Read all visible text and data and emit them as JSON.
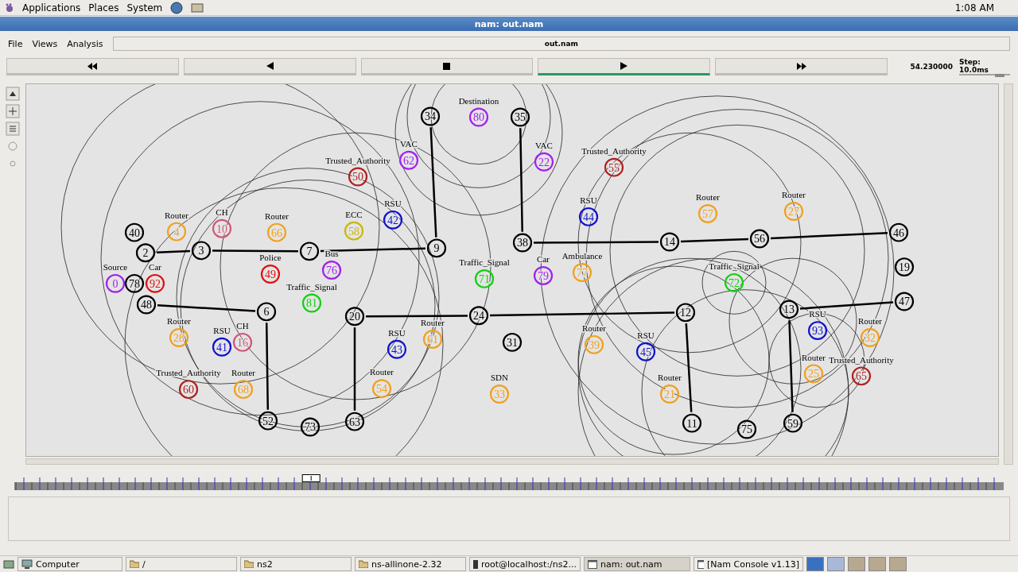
{
  "top_panel": {
    "menus": [
      "Applications",
      "Places",
      "System"
    ],
    "clock": "1:08 AM"
  },
  "window": {
    "title": "nam: out.nam"
  },
  "menubar": {
    "items": [
      "File",
      "Views",
      "Analysis"
    ],
    "file_name": "out.nam"
  },
  "transport": [
    {
      "kind": "rewind",
      "selected": false
    },
    {
      "kind": "back",
      "selected": false
    },
    {
      "kind": "stop",
      "selected": false
    },
    {
      "kind": "play",
      "selected": true
    },
    {
      "kind": "forward",
      "selected": false
    }
  ],
  "time": "54.230000",
  "step": {
    "label": "Step: 10.0ms",
    "level": 0.8
  },
  "nodes": [
    {
      "number": "40",
      "color": "#000000"
    },
    {
      "number": "2",
      "color": "#000000"
    },
    {
      "number": "3",
      "color": "#000000"
    },
    {
      "number": "7",
      "color": "#000000"
    },
    {
      "number": "48",
      "color": "#000000"
    },
    {
      "number": "6",
      "color": "#000000"
    },
    {
      "number": "52",
      "color": "#000000"
    },
    {
      "number": "73",
      "color": "#000000"
    },
    {
      "number": "20",
      "color": "#000000"
    },
    {
      "number": "63",
      "color": "#000000"
    },
    {
      "number": "9",
      "color": "#000000"
    },
    {
      "number": "34",
      "color": "#000000"
    },
    {
      "number": "35",
      "color": "#000000"
    },
    {
      "number": "38",
      "color": "#000000"
    },
    {
      "number": "24",
      "color": "#000000"
    },
    {
      "number": "31",
      "color": "#000000"
    },
    {
      "number": "14",
      "color": "#000000"
    },
    {
      "number": "56",
      "color": "#000000"
    },
    {
      "number": "46",
      "color": "#000000"
    },
    {
      "number": "19",
      "color": "#000000"
    },
    {
      "number": "47",
      "color": "#000000"
    },
    {
      "number": "12",
      "color": "#000000"
    },
    {
      "number": "13",
      "color": "#000000"
    },
    {
      "number": "11",
      "color": "#000000"
    },
    {
      "number": "75",
      "color": "#000000"
    },
    {
      "number": "59",
      "color": "#000000"
    },
    {
      "number": "0",
      "label": "Source",
      "color": "#a020f0"
    },
    {
      "number": "78",
      "color": "#000000"
    },
    {
      "number": "92",
      "label": "Car",
      "color": "#e01010"
    },
    {
      "number": "4",
      "label": "Router",
      "color": "#f0a020"
    },
    {
      "number": "10",
      "label": "CH",
      "color": "#d05878"
    },
    {
      "number": "66",
      "label": "Router",
      "color": "#f0a020"
    },
    {
      "number": "49",
      "label": "Police",
      "color": "#e01010"
    },
    {
      "number": "76",
      "label": "Bus",
      "color": "#a020f0"
    },
    {
      "number": "81",
      "label": "Traffic_Signal",
      "color": "#10d010"
    },
    {
      "number": "28",
      "label": "Router",
      "color": "#f0a020"
    },
    {
      "number": "41",
      "label": "RSU",
      "color": "#1010d0"
    },
    {
      "number": "16",
      "label": "CH",
      "color": "#d05878"
    },
    {
      "number": "60",
      "label": "Trusted_Authority",
      "color": "#b02020"
    },
    {
      "number": "68",
      "label": "Router",
      "color": "#f0a020"
    },
    {
      "number": "50",
      "label": "Trusted_Authority",
      "color": "#b02020"
    },
    {
      "number": "58",
      "label": "ECC",
      "color": "#c8b800"
    },
    {
      "number": "42",
      "label": "RSU",
      "color": "#1010d0"
    },
    {
      "number": "62",
      "label": "VAC",
      "color": "#a020f0"
    },
    {
      "number": "80",
      "label": "Destination",
      "color": "#a020f0"
    },
    {
      "number": "22",
      "label": "VAC",
      "color": "#a020f0"
    },
    {
      "number": "55",
      "label": "Trusted_Authority",
      "color": "#b02020"
    },
    {
      "number": "44",
      "label": "RSU",
      "color": "#1010d0"
    },
    {
      "number": "71",
      "label": "Traffic_Signal",
      "color": "#10d010"
    },
    {
      "number": "79",
      "label": "Car",
      "color": "#a020f0"
    },
    {
      "number": "77",
      "label": "Ambulance",
      "color": "#f0a020"
    },
    {
      "number": "43",
      "label": "RSU",
      "color": "#1010d0"
    },
    {
      "number": "61",
      "label": "Router",
      "color": "#f0a020"
    },
    {
      "number": "54",
      "label": "Router",
      "color": "#f0a020"
    },
    {
      "number": "33",
      "label": "SDN",
      "color": "#f0a020"
    },
    {
      "number": "39",
      "label": "Router",
      "color": "#f0a020"
    },
    {
      "number": "45",
      "label": "RSU",
      "color": "#1010d0"
    },
    {
      "number": "21",
      "label": "Router",
      "color": "#f0a020"
    },
    {
      "number": "57",
      "label": "Router",
      "color": "#f0a020"
    },
    {
      "number": "27",
      "label": "Router",
      "color": "#f0a020"
    },
    {
      "number": "72",
      "label": "Traffic_Signal",
      "color": "#10d010"
    },
    {
      "number": "93",
      "label": "RSU",
      "color": "#1010d0"
    },
    {
      "number": "32",
      "label": "Router",
      "color": "#f0a020"
    },
    {
      "number": "25",
      "label": "Router",
      "color": "#f0a020"
    },
    {
      "number": "65",
      "label": "Trusted_Authority",
      "color": "#b02020"
    }
  ],
  "timeline": {
    "level": 0.3
  },
  "taskbar": [
    {
      "label": "Computer",
      "kind": "computer",
      "selected": false
    },
    {
      "label": "/",
      "kind": "folder",
      "selected": false
    },
    {
      "label": "ns2",
      "kind": "folder",
      "selected": false
    },
    {
      "label": "ns-allinone-2.32",
      "kind": "folder",
      "selected": false
    },
    {
      "label": "root@localhost:/ns2...",
      "kind": "terminal",
      "selected": false
    },
    {
      "label": "nam: out.nam",
      "kind": "window",
      "selected": true
    },
    {
      "label": "[Nam Console v1.13]",
      "kind": "window",
      "selected": false
    }
  ]
}
